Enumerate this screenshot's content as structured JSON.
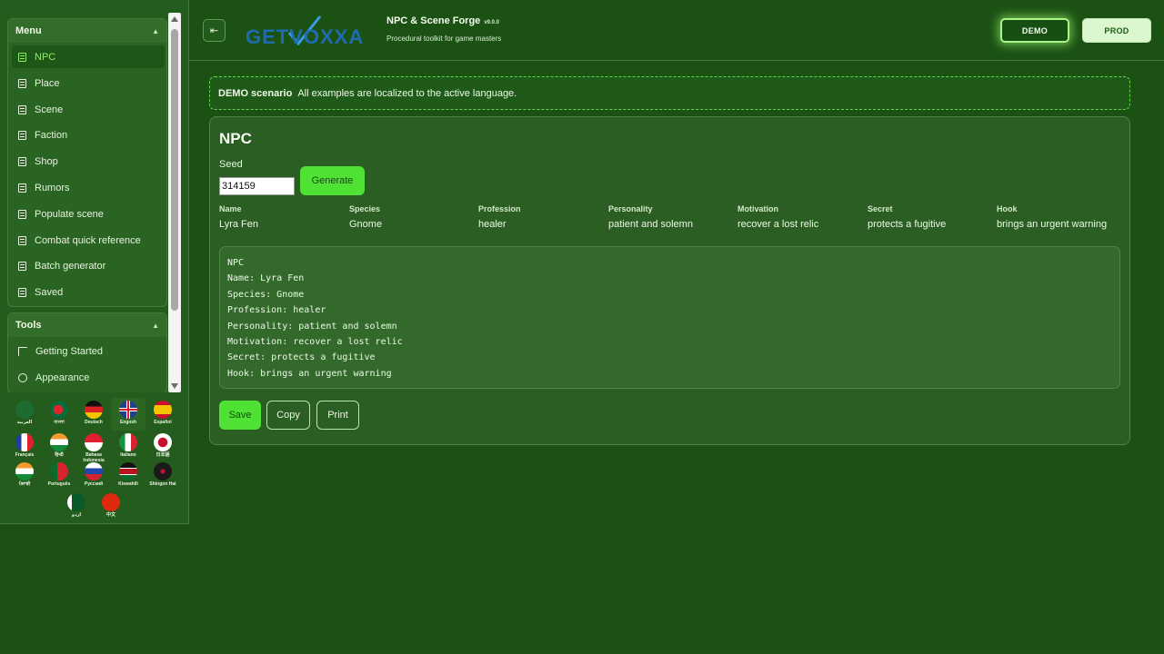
{
  "sidebar": {
    "menu": {
      "title": "Menu",
      "items": [
        {
          "label": "NPC",
          "active": true
        },
        {
          "label": "Place"
        },
        {
          "label": "Scene"
        },
        {
          "label": "Faction"
        },
        {
          "label": "Shop"
        },
        {
          "label": "Rumors"
        },
        {
          "label": "Populate scene"
        },
        {
          "label": "Combat quick reference"
        },
        {
          "label": "Batch generator"
        },
        {
          "label": "Saved"
        }
      ]
    },
    "tools": {
      "title": "Tools",
      "items": [
        {
          "label": "Getting Started",
          "icon": "external-icon"
        },
        {
          "label": "Appearance",
          "icon": "palette-icon"
        }
      ]
    },
    "languages": [
      {
        "label": "العربية",
        "flag": "flag-saudi"
      },
      {
        "label": "বাংলা",
        "flag": "flag-bangladesh"
      },
      {
        "label": "Deutsch",
        "flag": "flag-germany"
      },
      {
        "label": "English",
        "flag": "flag-uk",
        "selected": true
      },
      {
        "label": "Español",
        "flag": "flag-spain"
      },
      {
        "label": "Français",
        "flag": "flag-france"
      },
      {
        "label": "हिन्दी",
        "flag": "flag-india"
      },
      {
        "label": "Bahasa Indonesia",
        "flag": "flag-indonesia"
      },
      {
        "label": "Italiano",
        "flag": "flag-italy"
      },
      {
        "label": "日本語",
        "flag": "flag-japan"
      },
      {
        "label": "ਪੰਜਾਬੀ",
        "flag": "flag-india"
      },
      {
        "label": "Português",
        "flag": "flag-portugal"
      },
      {
        "label": "Русский",
        "flag": "flag-russia"
      },
      {
        "label": "Kiswahili",
        "flag": "flag-kenya"
      },
      {
        "label": "Shingon Hai",
        "flag": "flag-klingon"
      },
      {
        "label": "اردو",
        "flag": "flag-pakistan"
      },
      {
        "label": "中文",
        "flag": "flag-china"
      }
    ]
  },
  "header": {
    "logo_text": "GETVOXXA",
    "title": "NPC & Scene Forge",
    "version": "v9.0.0",
    "subtitle": "Procedural toolkit for game masters",
    "demo_label": "DEMO",
    "prod_label": "PROD"
  },
  "banner": {
    "label": "DEMO scenario",
    "text": "All examples are localized to the active language."
  },
  "npc": {
    "title": "NPC",
    "seed_label": "Seed",
    "seed_value": "314159",
    "generate_label": "Generate",
    "fields": [
      {
        "label": "Name",
        "value": "Lyra Fen"
      },
      {
        "label": "Species",
        "value": "Gnome"
      },
      {
        "label": "Profession",
        "value": "healer"
      },
      {
        "label": "Personality",
        "value": "patient and solemn"
      },
      {
        "label": "Motivation",
        "value": "recover a lost relic"
      },
      {
        "label": "Secret",
        "value": "protects a fugitive"
      },
      {
        "label": "Hook",
        "value": "brings an urgent warning"
      }
    ],
    "output_lines": [
      "NPC",
      "Name: Lyra Fen",
      "Species: Gnome",
      "Profession: healer",
      "Personality: patient and solemn",
      "Motivation: recover a lost relic",
      "Secret: protects a fugitive",
      "Hook: brings an urgent warning"
    ],
    "save_label": "Save",
    "copy_label": "Copy",
    "print_label": "Print"
  },
  "colors": {
    "background": "#1b5214",
    "accent": "#4fe234",
    "active_text": "#8ff06a"
  }
}
